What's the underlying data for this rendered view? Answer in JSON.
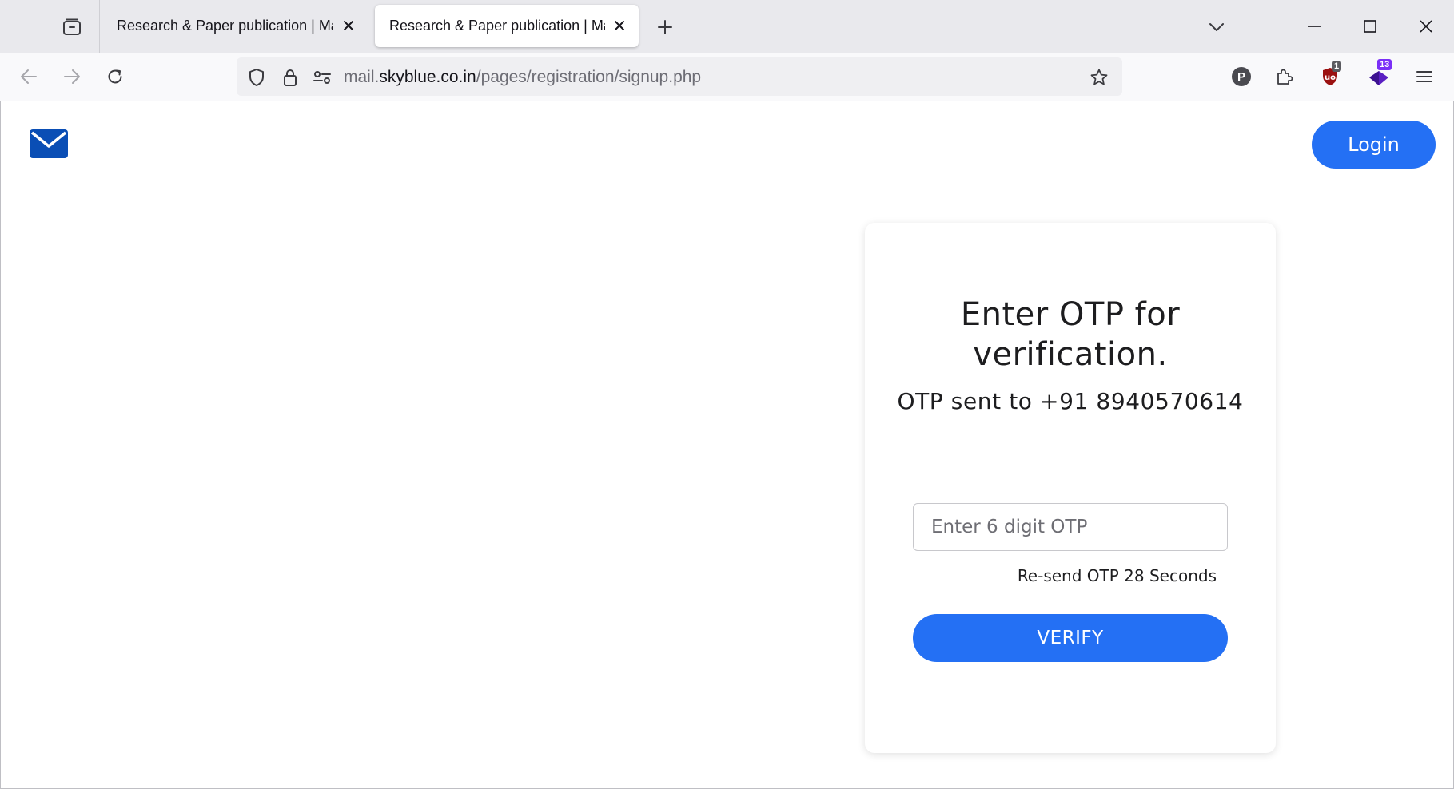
{
  "browser": {
    "tabs": [
      {
        "title": "Research & Paper publication | Mail",
        "active": false
      },
      {
        "title": "Research & Paper publication | Mail",
        "active": true
      }
    ],
    "url": {
      "prefix": "mail.",
      "host": "skyblue.co.in",
      "path": "/pages/registration/signup.php"
    },
    "extensions": {
      "profile_letter": "P",
      "ublock_badge": "1",
      "purple_badge": "13"
    }
  },
  "header": {
    "logo_icon": "envelope-icon",
    "login_label": "Login"
  },
  "otp_card": {
    "title": "Enter OTP for verification.",
    "subtitle": "OTP sent to +91 8940570614",
    "input_placeholder": "Enter 6 digit OTP",
    "input_value": "",
    "resend_text": "Re-send OTP 28 Seconds",
    "verify_label": "VERIFY"
  },
  "colors": {
    "accent": "#2470f4",
    "logo": "#0a4eb5"
  }
}
